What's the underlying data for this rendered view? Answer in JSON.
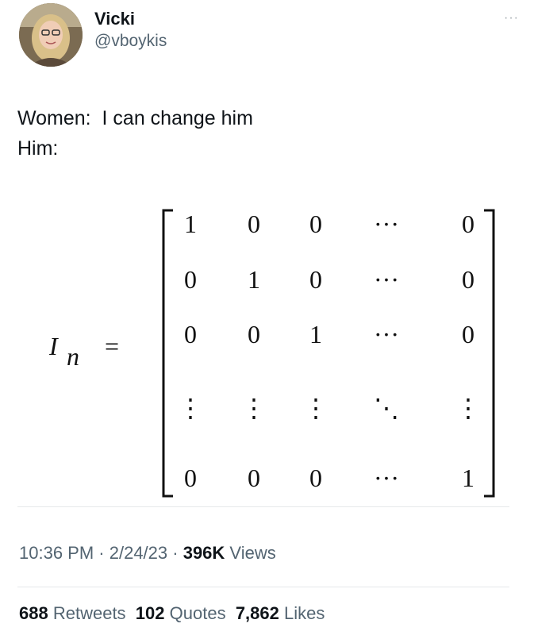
{
  "author": {
    "display_name": "Vicki",
    "handle": "@vboykis",
    "avatar_icon": "profile-photo"
  },
  "more_label": "···",
  "tweet": {
    "line1": "Women:  I can change him",
    "line2": "Him:"
  },
  "math": {
    "lhs": "I",
    "subscript": "n",
    "equals": "=",
    "rows": [
      [
        "1",
        "0",
        "0",
        "···",
        "0"
      ],
      [
        "0",
        "1",
        "0",
        "···",
        "0"
      ],
      [
        "0",
        "0",
        "1",
        "···",
        "0"
      ],
      [
        "⋮",
        "⋮",
        "⋮",
        "⋱",
        "⋮"
      ],
      [
        "0",
        "0",
        "0",
        "···",
        "1"
      ]
    ]
  },
  "meta": {
    "time": "10:36 PM",
    "date": "2/24/23",
    "views_count": "396K",
    "views_label": "Views"
  },
  "stats": {
    "retweets_count": "688",
    "retweets_label": "Retweets",
    "quotes_count": "102",
    "quotes_label": "Quotes",
    "likes_count": "7,862",
    "likes_label": "Likes"
  }
}
